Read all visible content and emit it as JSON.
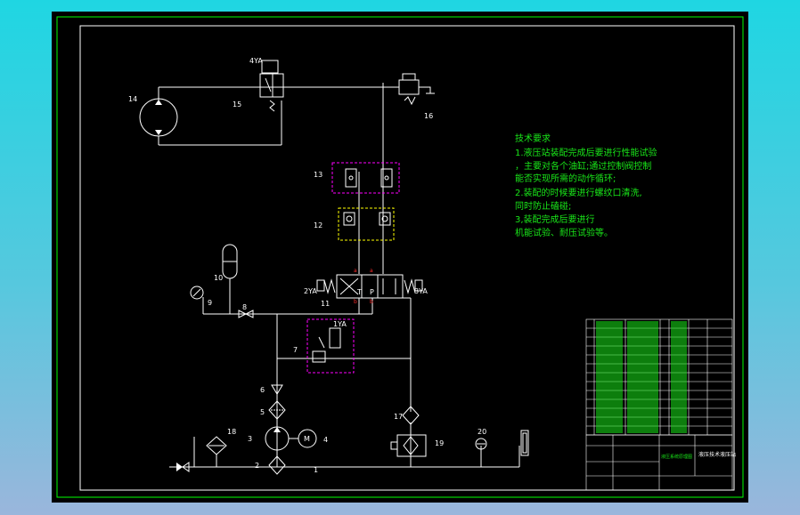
{
  "colors": {
    "background_top": "#1fd6e2",
    "sheet": "#000000",
    "frame": "#ffffff",
    "outer_frame": "#00ff00",
    "component_box": "#ff00ff",
    "component_box_alt": "#ffff00",
    "notes": "#19e619",
    "marker": "#ff2a2a"
  },
  "component_labels": {
    "n1": "1",
    "n2": "2",
    "n3": "3",
    "n4": "4",
    "n5": "5",
    "n6": "6",
    "n7": "7",
    "n8": "8",
    "n9": "9",
    "n10": "10",
    "n11": "11",
    "n12": "12",
    "n13": "13",
    "n14": "14",
    "n15": "15",
    "n16": "16",
    "n17": "17",
    "n18": "18",
    "n19": "19",
    "n20": "20"
  },
  "solenoid_labels": {
    "ya1": "1YA",
    "ya2": "2YA",
    "ya3": "3YA",
    "ya4": "4YA"
  },
  "port_labels": {
    "t": "T",
    "p": "P"
  },
  "technical_notes": {
    "heading": "技术要求",
    "line1": "1.液压站装配完成后要进行性能试验",
    "line2": "，主要对各个油缸;通过控制阀控制",
    "line3": "能否实现所需的动作循环;",
    "line4": "2.装配的时候要进行螺纹口清洗,",
    "line5": "同时防止磕碰;",
    "line6": "3,装配完成后要进行",
    "line7": "机能试验、耐压试验等。"
  },
  "title_block": {
    "title": "液压技术液压站",
    "drawing_name": "液压系统原理图"
  }
}
